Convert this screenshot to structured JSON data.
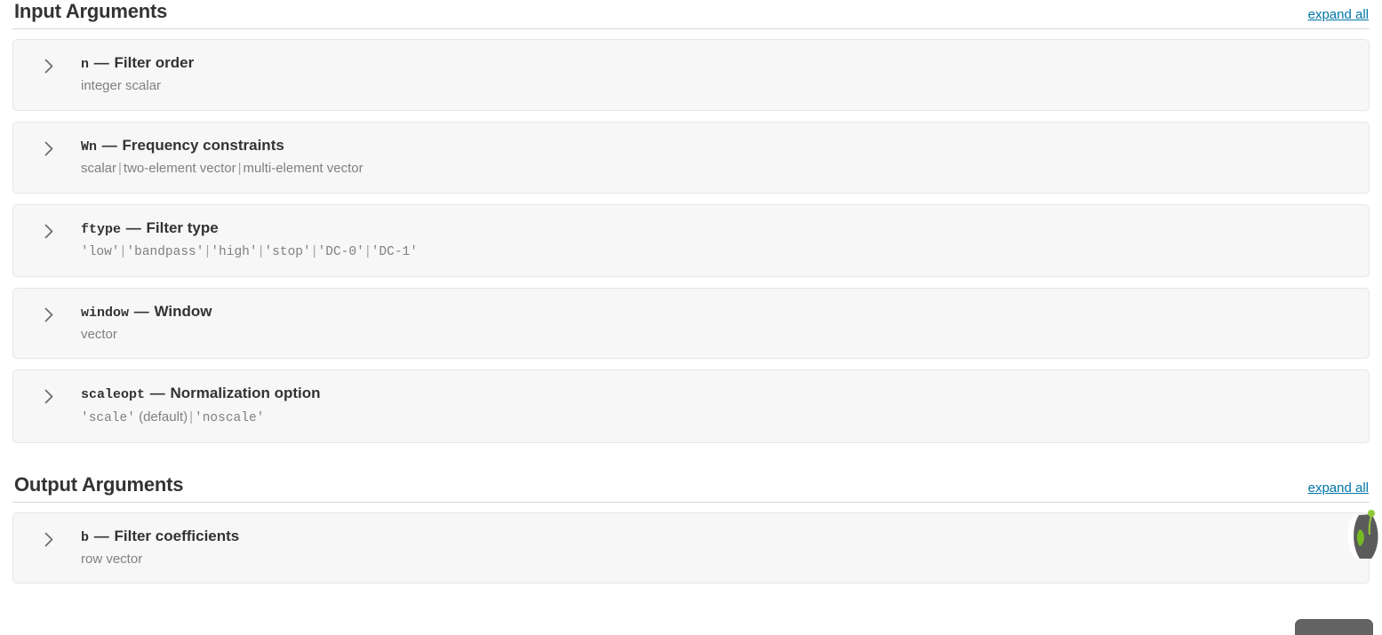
{
  "sections": [
    {
      "id": "input-arguments",
      "title": "Input Arguments",
      "expand_all_label": "expand all",
      "args": [
        {
          "name": "n",
          "separator": "—",
          "title": "Filter order",
          "sub_parts": [
            {
              "style": "plain",
              "text": "integer scalar"
            }
          ]
        },
        {
          "name": "Wn",
          "separator": "—",
          "title": "Frequency constraints",
          "sub_parts": [
            {
              "style": "plain",
              "text": "scalar"
            },
            {
              "style": "pipe",
              "text": "|"
            },
            {
              "style": "plain",
              "text": "two-element vector"
            },
            {
              "style": "pipe",
              "text": "|"
            },
            {
              "style": "plain",
              "text": "multi-element vector"
            }
          ]
        },
        {
          "name": "ftype",
          "separator": "—",
          "title": "Filter type",
          "sub_parts": [
            {
              "style": "code",
              "text": "'low'"
            },
            {
              "style": "pipe",
              "text": "|"
            },
            {
              "style": "code",
              "text": "'bandpass'"
            },
            {
              "style": "pipe",
              "text": "|"
            },
            {
              "style": "code",
              "text": "'high'"
            },
            {
              "style": "pipe",
              "text": "|"
            },
            {
              "style": "code",
              "text": "'stop'"
            },
            {
              "style": "pipe",
              "text": "|"
            },
            {
              "style": "code",
              "text": "'DC-0'"
            },
            {
              "style": "pipe",
              "text": "|"
            },
            {
              "style": "code",
              "text": "'DC-1'"
            }
          ]
        },
        {
          "name": "window",
          "separator": "—",
          "title": "Window",
          "sub_parts": [
            {
              "style": "plain",
              "text": "vector"
            }
          ]
        },
        {
          "name": "scaleopt",
          "separator": "—",
          "title": "Normalization option",
          "sub_parts": [
            {
              "style": "code",
              "text": "'scale'"
            },
            {
              "style": "plain",
              "text": " (default)"
            },
            {
              "style": "pipe",
              "text": "|"
            },
            {
              "style": "code",
              "text": "'noscale'"
            }
          ]
        }
      ]
    },
    {
      "id": "output-arguments",
      "title": "Output Arguments",
      "expand_all_label": "expand all",
      "args": [
        {
          "name": "b",
          "separator": "—",
          "title": "Filter coefficients",
          "sub_parts": [
            {
              "style": "plain",
              "text": "row vector"
            }
          ]
        }
      ]
    }
  ],
  "icons": {
    "chevron": "chevron-right-icon"
  },
  "colors": {
    "link": "#0076a8",
    "heading": "#333333",
    "subtext": "#808080",
    "card_bg": "#f7f7f7",
    "card_border": "#e6e6e6",
    "rule": "#d9d9d9"
  }
}
